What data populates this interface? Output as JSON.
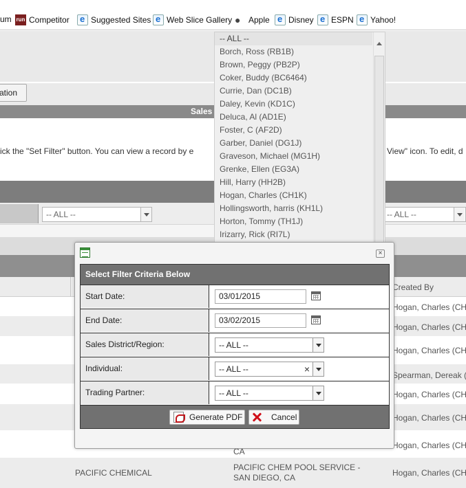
{
  "favorites": [
    {
      "label": "um",
      "icon": "none"
    },
    {
      "label": "Competitor",
      "icon": "run-icon"
    },
    {
      "label": "Suggested Sites",
      "icon": "ie-icon"
    },
    {
      "label": "Web Slice Gallery",
      "icon": "ie-icon"
    },
    {
      "label": "Apple",
      "icon": "apple-icon"
    },
    {
      "label": "Disney",
      "icon": "ie-icon"
    },
    {
      "label": "ESPN",
      "icon": "ie-icon"
    },
    {
      "label": "Yahoo!",
      "icon": "ie-icon"
    }
  ],
  "page": {
    "ation_button": "ation",
    "section_title": "Sales",
    "instructions_left": "ick the \"Set Filter\" button. You can view a record by e",
    "instructions_right": "View\" icon. To edit, d",
    "filter_all": "-- ALL --",
    "filter_all_right": "-- ALL --",
    "created_by_header": "Created By",
    "rows": [
      {
        "col_b": "",
        "col_c": "",
        "created_by": "Hogan, Charles (CH1"
      },
      {
        "col_b": "",
        "col_c": "",
        "created_by": "Hogan, Charles (CH1"
      },
      {
        "col_b": "",
        "col_c": "",
        "created_by": "Hogan, Charles (CH1"
      },
      {
        "col_b": "",
        "col_c": "",
        "created_by": "Spearman, Dereak (D"
      },
      {
        "col_b": "",
        "col_c": "",
        "created_by": "Hogan, Charles (CH1"
      },
      {
        "col_b": "",
        "col_c": "",
        "created_by": "Hogan, Charles (CH1"
      },
      {
        "col_b": "",
        "col_c": "CA",
        "created_by": "Hogan, Charles (CH1"
      },
      {
        "col_b": "PACIFIC CHEMICAL",
        "col_c": "PACIFIC CHEM POOL SERVICE - SAN DIEGO, CA",
        "created_by": "Hogan, Charles (CH1"
      }
    ]
  },
  "dropdown": {
    "items": [
      "-- ALL --",
      "Borch, Ross (RB1B)",
      "Brown, Peggy (PB2P)",
      "Coker, Buddy (BC6464)",
      "Currie, Dan (DC1B)",
      "Daley, Kevin (KD1C)",
      "Deluca, Al (AD1E)",
      "Foster, C (AF2D)",
      "Garber, Daniel (DG1J)",
      "Graveson, Michael (MG1H)",
      "Grenke, Ellen (EG3A)",
      "Hill, Harry (HH2B)",
      "Hogan, Charles (CH1K)",
      "Hollingsworth, harris (KH1L)",
      "Horton, Tommy (TH1J)",
      "Irizarry, Rick (RI7L)"
    ]
  },
  "modal": {
    "header": "Select Filter Criteria Below",
    "close_symbol": "×",
    "start_date_label": "Start Date:",
    "start_date_value": "03/01/2015",
    "end_date_label": "End Date:",
    "end_date_value": "03/02/2015",
    "district_label": "Sales District/Region:",
    "district_value": "-- ALL --",
    "individual_label": "Individual:",
    "individual_value": "-- ALL --",
    "individual_clear": "×",
    "partner_label": "Trading Partner:",
    "partner_value": "-- ALL --",
    "generate_pdf": "Generate PDF",
    "cancel": "Cancel"
  }
}
